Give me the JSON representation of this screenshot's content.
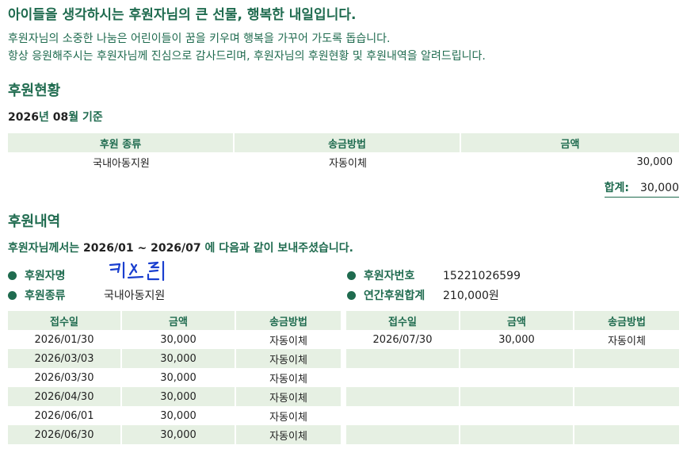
{
  "headline": "아이들을 생각하시는 후원자님의 큰 선물, 행복한 내일입니다.",
  "intro": [
    "후원자님의 소중한 나눔은 어린이들이 꿈을 키우며 행복을 가꾸어 가도록 돕습니다.",
    "항상 응원해주시는 후원자님께 진심으로 감사드리며, 후원자님의 후원현황 및 후원내역을 알려드립니다."
  ],
  "status": {
    "title": "후원현황",
    "date_line": {
      "year": "2026",
      "year_unit": "년",
      "month": "08",
      "month_unit": "월",
      "suffix": "기준"
    },
    "columns": [
      "후원 종류",
      "송금방법",
      "금액"
    ],
    "rows": [
      {
        "type": "국내아동지원",
        "method": "자동이체",
        "amount": "30,000"
      }
    ],
    "total_label": "합계:",
    "total_value": "30,000"
  },
  "history": {
    "title": "후원내역",
    "period_line": {
      "prefix": "후원자님께서는",
      "range": "2026/01 ~ 2026/07",
      "suffix": "에 다음과 같이 보내주셨습니다."
    },
    "donor_name_label": "후원자명",
    "donor_name_signature": "키스팀",
    "donor_type_label": "후원종류",
    "donor_type_value": "국내아동지원",
    "donor_no_label": "후원자번호",
    "donor_no_value": "15221026599",
    "annual_label": "연간후원합계",
    "annual_value": "210,000원",
    "columns": [
      "접수일",
      "금액",
      "송금방법"
    ],
    "left_rows": [
      {
        "date": "2026/01/30",
        "amount": "30,000",
        "method": "자동이체"
      },
      {
        "date": "2026/03/03",
        "amount": "30,000",
        "method": "자동이체"
      },
      {
        "date": "2026/03/30",
        "amount": "30,000",
        "method": "자동이체"
      },
      {
        "date": "2026/04/30",
        "amount": "30,000",
        "method": "자동이체"
      },
      {
        "date": "2026/06/01",
        "amount": "30,000",
        "method": "자동이체"
      },
      {
        "date": "2026/06/30",
        "amount": "30,000",
        "method": "자동이체"
      }
    ],
    "right_rows": [
      {
        "date": "2026/07/30",
        "amount": "30,000",
        "method": "자동이체"
      },
      {
        "date": "",
        "amount": "",
        "method": ""
      },
      {
        "date": "",
        "amount": "",
        "method": ""
      },
      {
        "date": "",
        "amount": "",
        "method": ""
      },
      {
        "date": "",
        "amount": "",
        "method": ""
      },
      {
        "date": "",
        "amount": "",
        "method": ""
      }
    ]
  }
}
